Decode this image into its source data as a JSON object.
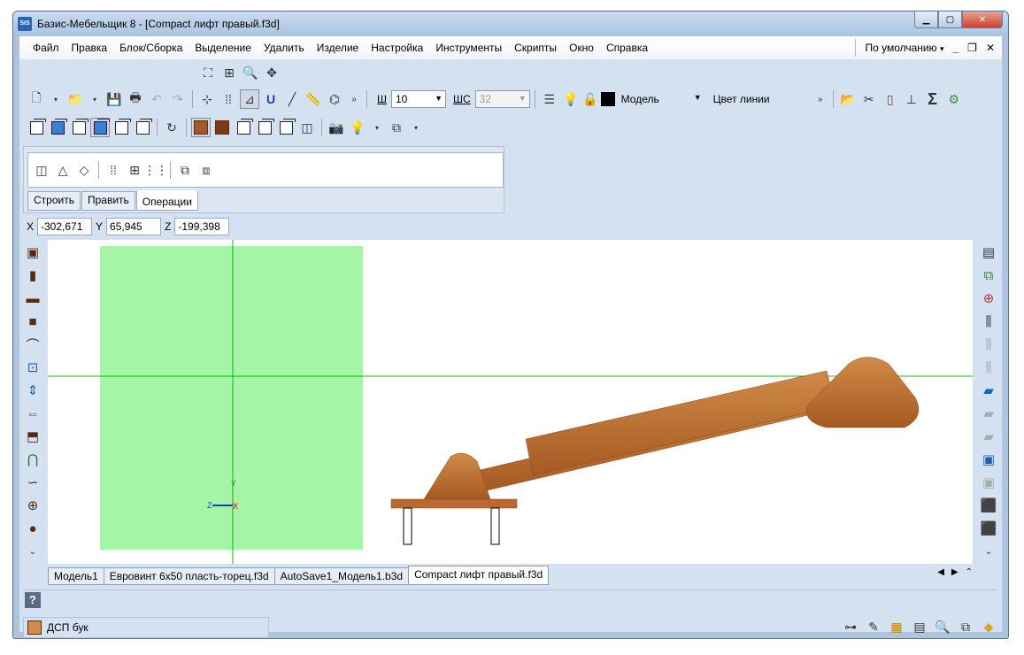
{
  "window": {
    "app_icon_text": "SIS",
    "title": "Базис-Мебельщик 8 - [Compact лифт правый.f3d]"
  },
  "menu": {
    "items": [
      "Файл",
      "Правка",
      "Блок/Сборка",
      "Выделение",
      "Удалить",
      "Изделие",
      "Настройка",
      "Инструменты",
      "Скрипты",
      "Окно",
      "Справка"
    ],
    "profile": "По умолчанию"
  },
  "toolbar": {
    "sh_label": "Ш",
    "sh_value": "10",
    "shs_label": "ШС",
    "shs_value": "32",
    "layer_value": "Модель",
    "line_color_label": "Цвет линии"
  },
  "ops_panel": {
    "tabs": [
      "Строить",
      "Править",
      "Операции"
    ],
    "active_tab": "Операции"
  },
  "coords": {
    "x_label": "X",
    "x_value": "-302,671",
    "y_label": "Y",
    "y_value": "65,945",
    "z_label": "Z",
    "z_value": "-199,398"
  },
  "viewport": {
    "axis_y_label": "Y",
    "axis_z_label": "Z",
    "axis_x_label": "X",
    "grid_color": "#00cc00",
    "panel_color": "#a6f5a6",
    "part_color": "#c47a3c"
  },
  "doc_tabs": [
    "Модель1",
    "Евровинт 6x50 пласть-торец.f3d",
    "AutoSave1_Модель1.b3d",
    "Compact лифт правый.f3d"
  ],
  "status": {
    "help_icon": "?",
    "material": "ДСП бук"
  }
}
